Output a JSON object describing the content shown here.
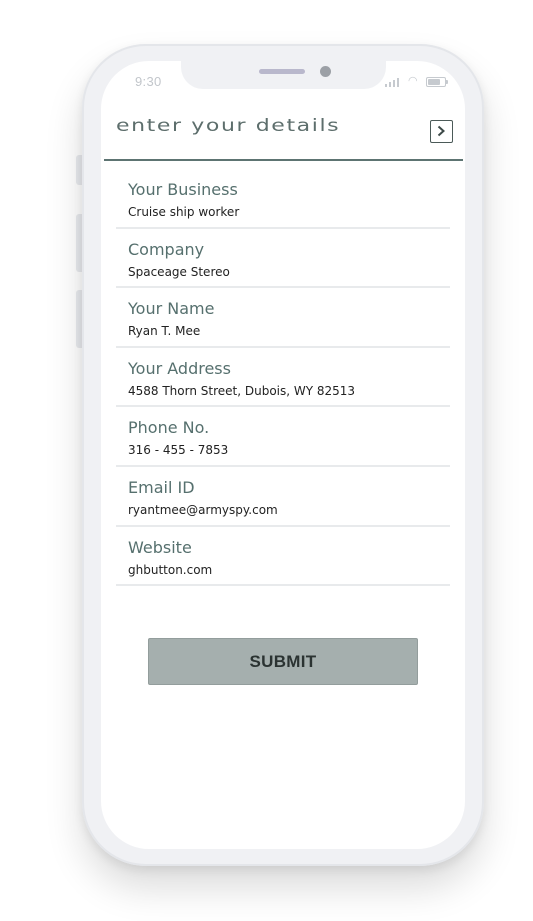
{
  "status_bar": {
    "time": "9:30",
    "battery_level": 0.85,
    "icons": [
      "signal-icon",
      "wifi-icon",
      "battery-icon"
    ]
  },
  "header": {
    "title": "enter your details",
    "next_icon": "chevron-right-icon"
  },
  "form": {
    "fields": [
      {
        "label": "Your Business",
        "value": "Cruise ship worker"
      },
      {
        "label": "Company",
        "value": "Spaceage Stereo"
      },
      {
        "label": "Your Name",
        "value": "Ryan T. Mee"
      },
      {
        "label": "Your Address",
        "value": "4588 Thorn Street, Dubois, WY 82513"
      },
      {
        "label": "Phone No.",
        "value": "316 - 455 - 7853"
      },
      {
        "label": "Email ID",
        "value": "ryantmee@armyspy.com"
      },
      {
        "label": "Website",
        "value": "ghbutton.com"
      }
    ],
    "submit_label": "SUBMIT"
  },
  "colors": {
    "accent": "#5d7472",
    "label": "#56706e",
    "button_bg": "#a5afae",
    "divider": "#e8eaec"
  }
}
